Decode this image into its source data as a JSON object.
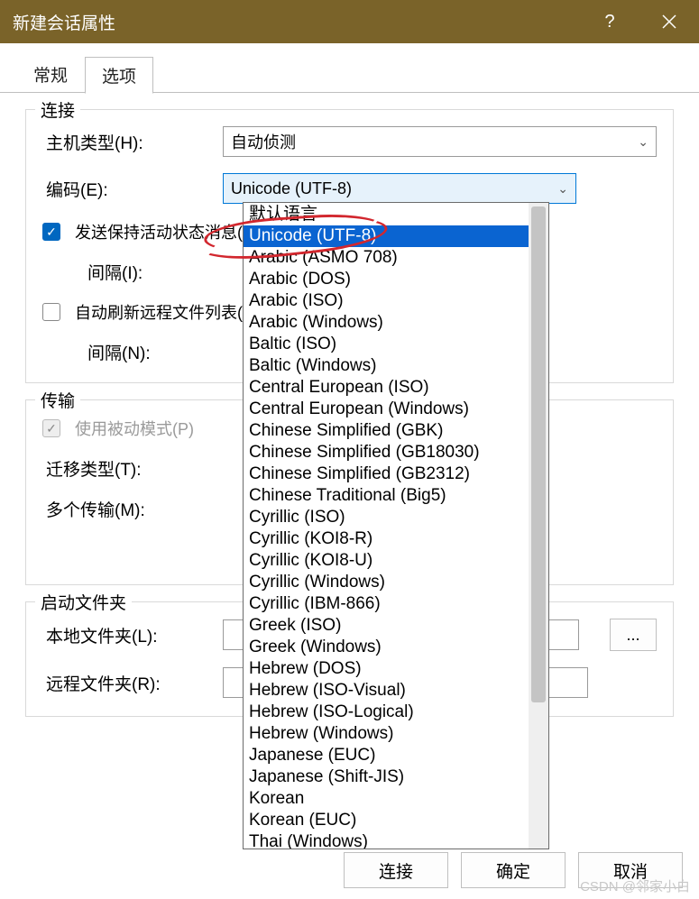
{
  "window": {
    "title": "新建会话属性"
  },
  "tabs": {
    "general": "常规",
    "options": "选项"
  },
  "connection": {
    "legend": "连接",
    "host_type_label": "主机类型(H):",
    "host_type_value": "自动侦测",
    "encoding_label": "编码(E):",
    "encoding_value": "Unicode (UTF-8)",
    "keep_alive_label": "发送保持活动状态消息(S",
    "interval1_label": "间隔(I):",
    "auto_refresh_label": "自动刷新远程文件列表(A",
    "interval2_label": "间隔(N):"
  },
  "transport": {
    "legend": "传输",
    "passive_label": "使用被动模式(P)",
    "transfer_type_label": "迁移类型(T):",
    "multiple_label": "多个传输(M):"
  },
  "startup": {
    "legend": "启动文件夹",
    "local_label": "本地文件夹(L):",
    "remote_label": "远程文件夹(R):",
    "browse": "..."
  },
  "footer": {
    "connect": "连接",
    "ok": "确定",
    "cancel": "取消"
  },
  "watermark": "CSDN @邻家小白",
  "encoding_options": {
    "selected_index": 1,
    "items": [
      "默认语言",
      "Unicode (UTF-8)",
      "Arabic (ASMO 708)",
      "Arabic (DOS)",
      "Arabic (ISO)",
      "Arabic (Windows)",
      "Baltic (ISO)",
      "Baltic (Windows)",
      "Central European (ISO)",
      "Central European (Windows)",
      "Chinese Simplified (GBK)",
      "Chinese Simplified (GB18030)",
      "Chinese Simplified (GB2312)",
      "Chinese Traditional (Big5)",
      "Cyrillic (ISO)",
      "Cyrillic (KOI8-R)",
      "Cyrillic (KOI8-U)",
      "Cyrillic (Windows)",
      "Cyrillic (IBM-866)",
      "Greek (ISO)",
      "Greek (Windows)",
      "Hebrew (DOS)",
      "Hebrew (ISO-Visual)",
      "Hebrew (ISO-Logical)",
      "Hebrew (Windows)",
      "Japanese (EUC)",
      "Japanese (Shift-JIS)",
      "Korean",
      "Korean (EUC)",
      "Thai (Windows)"
    ]
  }
}
